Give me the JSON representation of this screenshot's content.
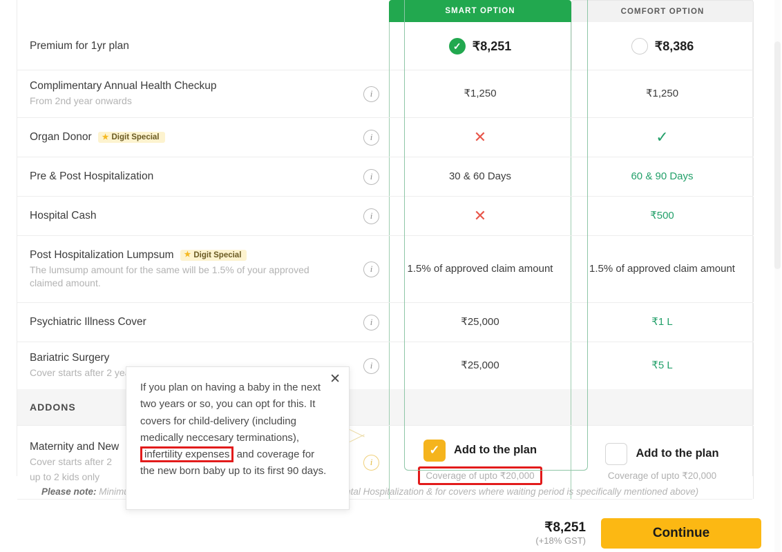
{
  "header": {
    "smart": {
      "label": "SMART OPTION",
      "price": "₹8,251",
      "selected": true
    },
    "comfort": {
      "label": "COMFORT OPTION",
      "price": "₹8,386",
      "selected": false
    },
    "premium_label": "Premium for 1yr plan"
  },
  "badge_special": "Digit Special",
  "rows": [
    {
      "title": "Complimentary Annual Health Checkup",
      "sub": "From 2nd year onwards",
      "badge": false,
      "smart": "₹1,250",
      "comfort": "₹1,250",
      "smart_kind": "text",
      "comfort_kind": "text",
      "comfort_better": false
    },
    {
      "title": "Organ Donor",
      "sub": "",
      "badge": true,
      "smart": "✕",
      "comfort": "✓",
      "smart_kind": "cross",
      "comfort_kind": "tick",
      "comfort_better": true
    },
    {
      "title": "Pre & Post Hospitalization",
      "sub": "",
      "badge": false,
      "smart": "30 & 60 Days",
      "comfort": "60 & 90 Days",
      "smart_kind": "text",
      "comfort_kind": "text",
      "comfort_better": true
    },
    {
      "title": "Hospital Cash",
      "sub": "",
      "badge": false,
      "smart": "✕",
      "comfort": "₹500",
      "smart_kind": "cross",
      "comfort_kind": "text",
      "comfort_better": true
    },
    {
      "title": "Post Hospitalization Lumpsum",
      "sub": "The lumsump amount for the same will be 1.5% of your approved claimed amount.",
      "badge": true,
      "smart": "1.5% of approved claim amount",
      "comfort": "1.5% of approved claim amount",
      "smart_kind": "text",
      "comfort_kind": "text",
      "comfort_better": false
    },
    {
      "title": "Psychiatric Illness Cover",
      "sub": "",
      "badge": false,
      "smart": "₹25,000",
      "comfort": "₹1 L",
      "smart_kind": "text",
      "comfort_kind": "text",
      "comfort_better": true
    },
    {
      "title": "Bariatric Surgery",
      "sub": "Cover starts after 2 years of waiting period",
      "badge": false,
      "smart": "₹25,000",
      "comfort": "₹5 L",
      "smart_kind": "text",
      "comfort_kind": "text",
      "comfort_better": true
    }
  ],
  "addons": {
    "section_label": "ADDONS",
    "row": {
      "title": "Maternity and New",
      "sub_line1": "Cover starts after 2",
      "sub_line2": "up to 2 kids only"
    },
    "smart": {
      "checked": true,
      "add_label": "Add to the plan",
      "coverage": "Coverage of upto ₹20,000",
      "highlighted": true
    },
    "comfort": {
      "checked": false,
      "add_label": "Add to the plan",
      "coverage": "Coverage of upto ₹20,000",
      "highlighted": false
    }
  },
  "please_note": {
    "prefix": "Please note:",
    "line1_a": "Minimu",
    "line1_b": "for Accidental Hospitalization & for covers where waiting period is specifically",
    "line2": "mentioned above)"
  },
  "tooltip": {
    "part1": "If you plan on having a baby in the next two years or so, you can opt for this. It covers for child-delivery (including medically neccesary terminations),",
    "highlight": "infertility expenses",
    "part2": "and coverage for the new born baby up to its first 90 days.",
    "close": "✕"
  },
  "footer": {
    "amount": "₹8,251",
    "gst": "(+18% GST)",
    "continue_label": "Continue"
  },
  "colors": {
    "green": "#22a84f",
    "green_text": "#23a06a",
    "red": "#e8564a",
    "yellow": "#fcb813",
    "highlight_red": "#e21b1b"
  }
}
